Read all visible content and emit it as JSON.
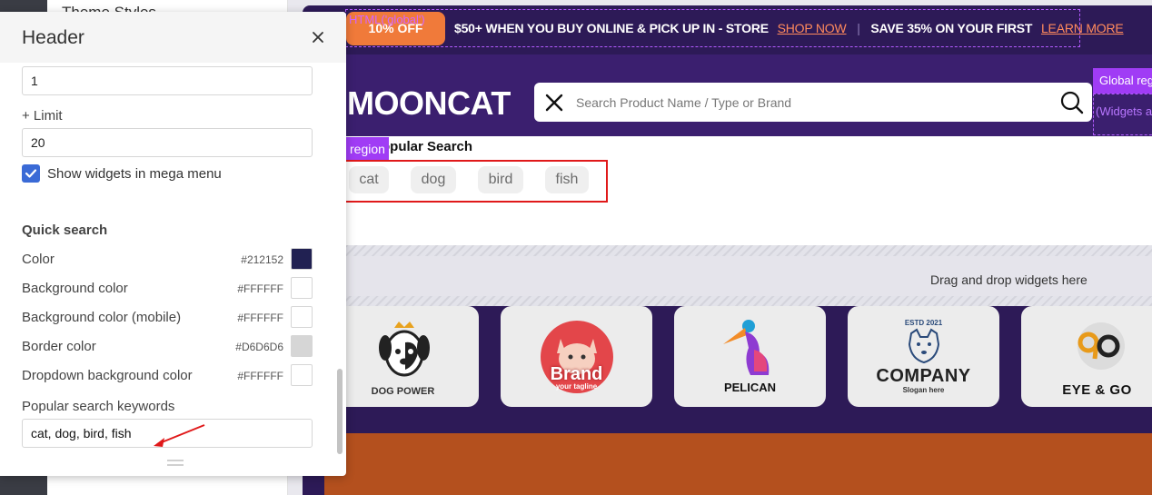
{
  "sidebar": {
    "theme_styles_label": "Theme Styles"
  },
  "panel": {
    "title": "Header",
    "top_input_value": "1",
    "limit_label": "+ Limit",
    "limit_value": "20",
    "show_widgets_label": "Show widgets in mega menu",
    "show_widgets_checked": true,
    "quick_search_title": "Quick search",
    "colors": [
      {
        "label": "Color",
        "hex": "#212152",
        "swatch": "#212152"
      },
      {
        "label": "Background color",
        "hex": "#FFFFFF",
        "swatch": "#FFFFFF"
      },
      {
        "label": "Background color (mobile)",
        "hex": "#FFFFFF",
        "swatch": "#FFFFFF"
      },
      {
        "label": "Border color",
        "hex": "#D6D6D6",
        "swatch": "#D6D6D6"
      },
      {
        "label": "Dropdown background color",
        "hex": "#FFFFFF",
        "swatch": "#FFFFFF"
      }
    ],
    "popular_keywords_label": "Popular search keywords",
    "popular_keywords_value": "cat, dog, bird, fish"
  },
  "preview": {
    "promo": {
      "html_tag": "HTML('global')",
      "badge": "10% OFF",
      "text_main": "$50+ WHEN YOU BUY ONLINE & PICK UP IN - STORE",
      "link_1": "SHOP NOW",
      "separator": "|",
      "text_second": "SAVE 35% ON YOUR FIRST",
      "link_2": "LEARN MORE"
    },
    "logo": "MOONCAT",
    "search_placeholder": "Search Product Name / Type or Brand",
    "global_region_tag": "Global region",
    "global_region_hint": "(Widgets added here",
    "region_tag": "region",
    "popular_search_title": "Popular Search",
    "keywords": [
      "cat",
      "dog",
      "bird",
      "fish"
    ],
    "dropzone_text": "Drag and drop widgets here",
    "brands": [
      {
        "name": "DOG POWER",
        "sub": ""
      },
      {
        "name": "Brand",
        "sub": "your tagline"
      },
      {
        "name": "PELICAN",
        "sub": ""
      },
      {
        "name": "COMPANY",
        "sub": "Slogan here",
        "top": "ESTD 2021"
      },
      {
        "name": "EYE & GO",
        "sub": ""
      }
    ]
  },
  "theme": {
    "accent": "#3a6ad6",
    "header_bg": "#3b1f6f",
    "dark_bg": "#2d1a57",
    "promo_badge": "#f07a3a",
    "highlight_red": "#e0191a",
    "region_purple": "#a03cf5"
  }
}
